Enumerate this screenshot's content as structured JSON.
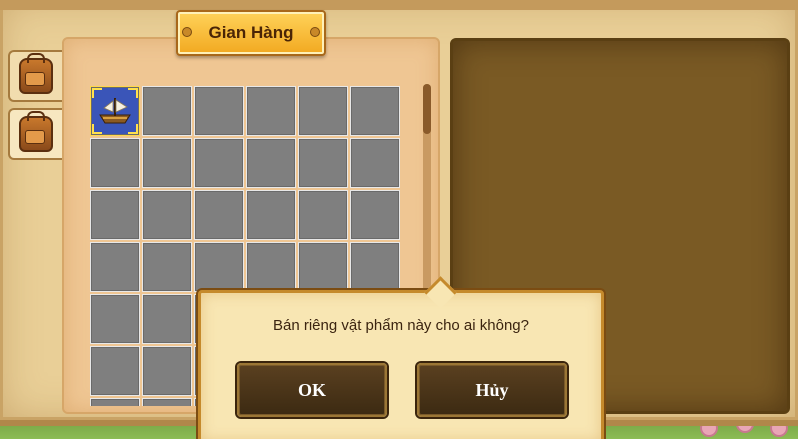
{
  "window": {
    "title": "Gian Hàng"
  },
  "side_tabs": [
    {
      "icon": "backpack-icon",
      "active": false
    },
    {
      "icon": "backpack-icon",
      "active": true
    }
  ],
  "inventory": {
    "columns": 6,
    "visible_rows": 7,
    "slots": [
      {
        "item": "ship-icon",
        "selected": true
      }
    ]
  },
  "dialog": {
    "message": "Bán riêng vật phẩm này cho ai không?",
    "ok_label": "OK",
    "cancel_label": "Hủy"
  },
  "colors": {
    "slot_empty": "#7f7f7f",
    "slot_selected": "#3a55b8",
    "title_plate": "#f2a920",
    "right_panel": "#7a5a24",
    "button": "#3c2a12"
  }
}
